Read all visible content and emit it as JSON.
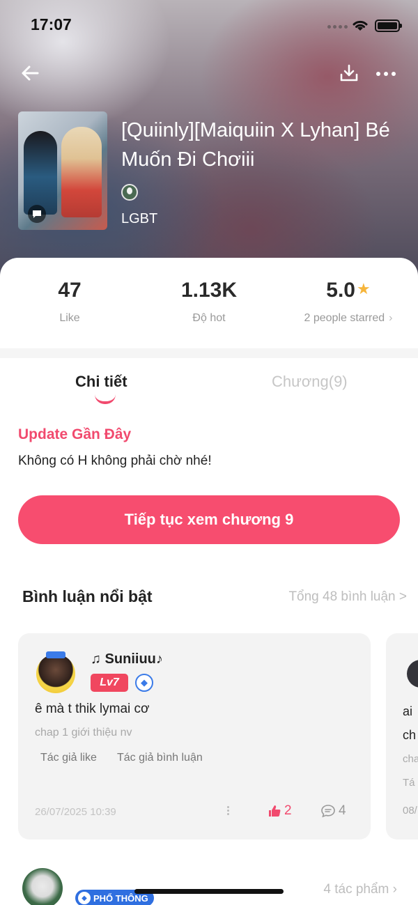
{
  "status_bar": {
    "time": "17:07"
  },
  "story": {
    "title": "[Quiinly][Maiquiin X Lyhan] Bé Muốn Đi Chơiii",
    "genre": "LGBT"
  },
  "stats": {
    "likes": {
      "value": "47",
      "label": "Like"
    },
    "hot": {
      "value": "1.13K",
      "label": "Độ hot"
    },
    "rating": {
      "value": "5.0",
      "label": "2 people starred",
      "chevron": "›"
    }
  },
  "tabs": [
    {
      "label": "Chi tiết",
      "active": true
    },
    {
      "label": "Chương(9)",
      "active": false
    }
  ],
  "update": {
    "title": "Update Gần Đây",
    "text": "Không có H không phải chờ nhé!"
  },
  "continue_button": {
    "label": "Tiếp tục xem chương 9"
  },
  "comments": {
    "title": "Bình luận nổi bật",
    "total": "Tổng 48 bình luận >",
    "items": [
      {
        "user": "♫ Suniiuu♪",
        "level": "Lv7",
        "text": "ê mà t thik lymai cơ",
        "chapter": "chap 1 giới thiệu nv",
        "tags": [
          "Tác giả like",
          "Tác giả bình luận"
        ],
        "date": "26/07/2025 10:39",
        "likes": "2",
        "replies": "4"
      },
      {
        "text_fragment": "ai",
        "chapter_fragment": "ch",
        "sub_fragment": "cha",
        "tag_fragment": "Tá",
        "date_fragment": "08/"
      }
    ]
  },
  "author": {
    "badge": "PHỔ THÔNG",
    "works": "4 tác phẩm"
  },
  "colors": {
    "accent": "#f74d6f",
    "accent_text": "#f14a6e",
    "star": "#f6b53b",
    "badge_blue": "#2f6fe0"
  }
}
